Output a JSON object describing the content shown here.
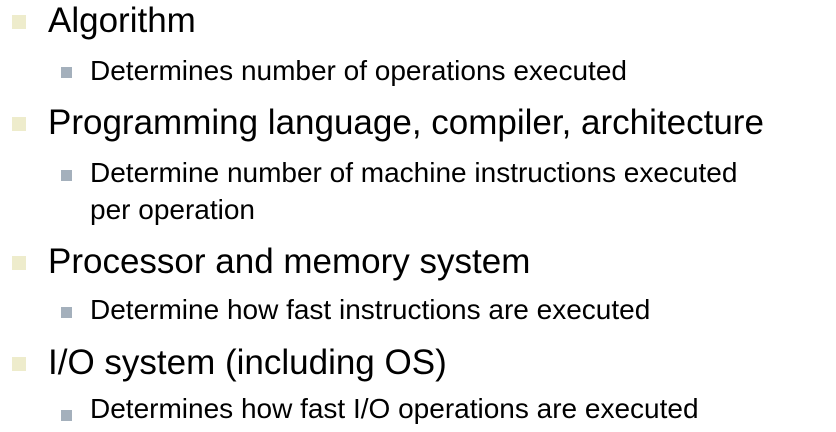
{
  "bullets": [
    {
      "text": "Algorithm",
      "sub": [
        "Determines number of operations executed"
      ]
    },
    {
      "text": "Programming language, compiler, architecture",
      "sub": [
        "Determine number of machine instructions executed",
        "per operation"
      ]
    },
    {
      "text": "Processor and memory system",
      "sub": [
        "Determine how fast instructions are executed"
      ]
    },
    {
      "text": "I/O system (including OS)",
      "sub": [
        "Determines how fast I/O operations are executed"
      ]
    }
  ],
  "colors": {
    "level1_bullet": "#eeeccc",
    "level2_bullet": "#a4b0bc",
    "text": "#000000",
    "background": "#ffffff"
  }
}
